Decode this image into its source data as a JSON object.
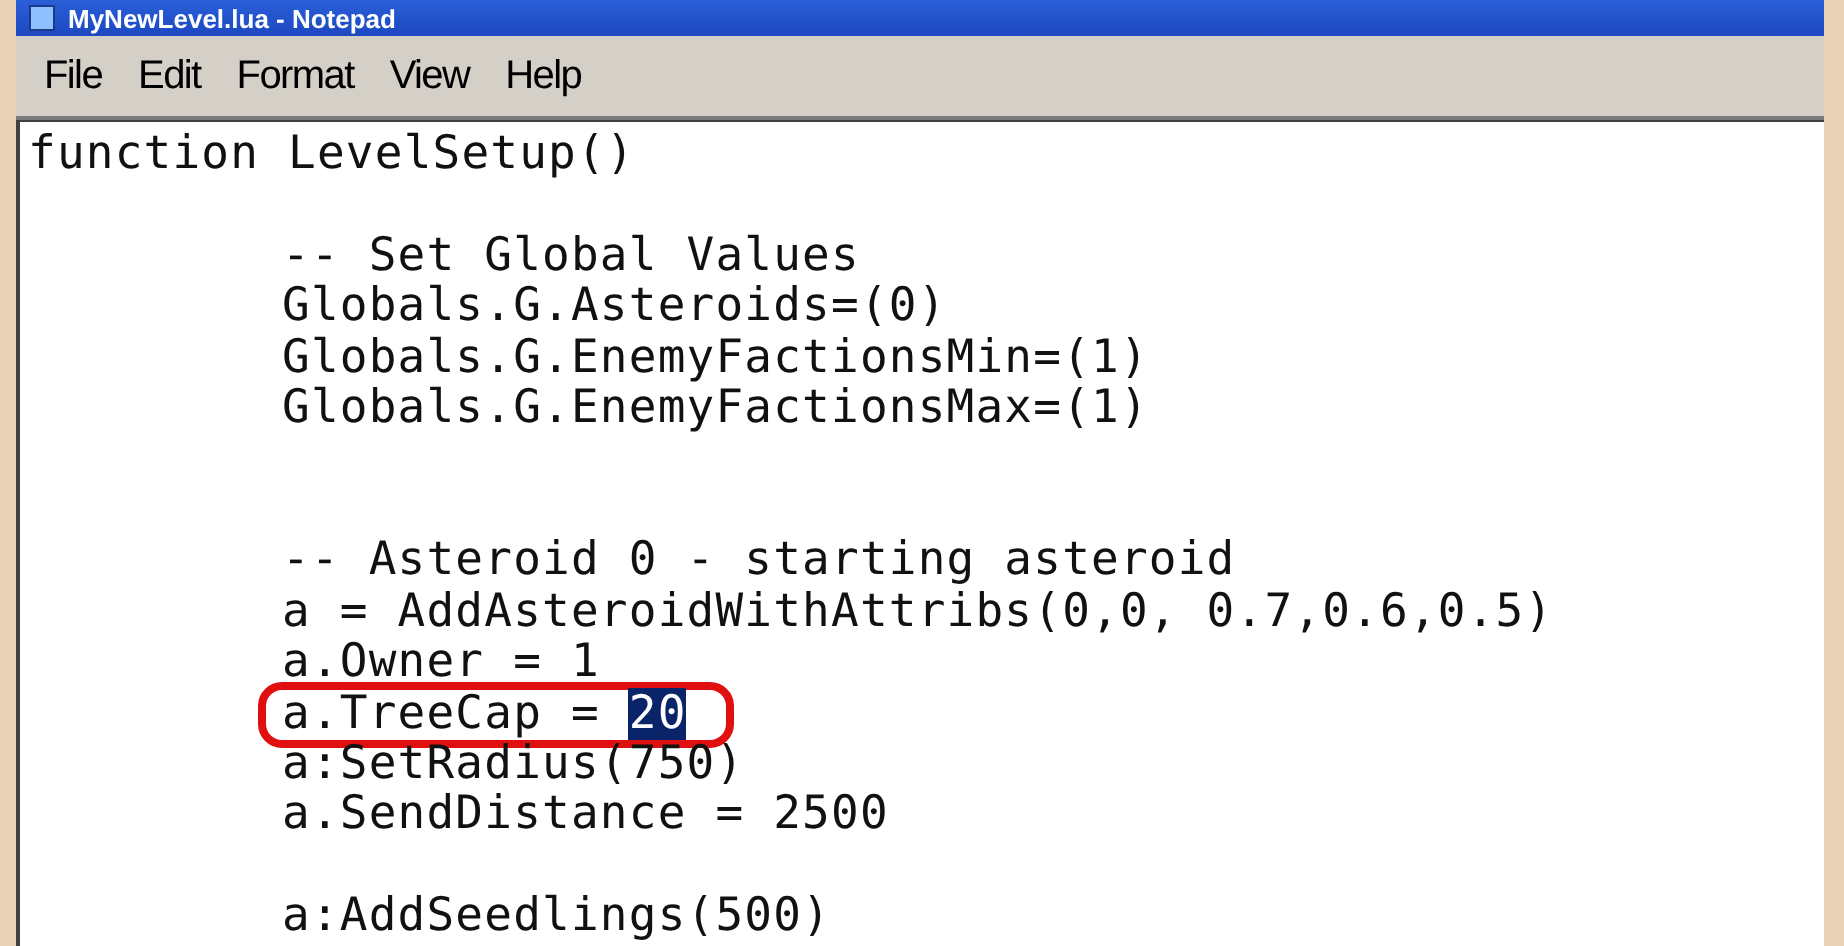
{
  "window": {
    "title": "MyNewLevel.lua - Notepad"
  },
  "menu": [
    "File",
    "Edit",
    "Format",
    "View",
    "Help"
  ],
  "lines": [
    {
      "kind": "top",
      "text": "function LevelSetup()"
    },
    {
      "kind": "gap"
    },
    {
      "kind": "body",
      "text": "-- Set Global Values"
    },
    {
      "kind": "body",
      "text": "Globals.G.Asteroids=(0)"
    },
    {
      "kind": "body",
      "text": "Globals.G.EnemyFactionsMin=(1)"
    },
    {
      "kind": "body",
      "text": "Globals.G.EnemyFactionsMax=(1)"
    },
    {
      "kind": "gap"
    },
    {
      "kind": "gap"
    },
    {
      "kind": "body",
      "text": "-- Asteroid 0 - starting asteroid"
    },
    {
      "kind": "body",
      "text": "a = AddAsteroidWithAttribs(0,0, 0.7,0.6,0.5)"
    },
    {
      "kind": "body",
      "text": "a.Owner = 1"
    },
    {
      "kind": "marked",
      "text": "a.TreeCap = ",
      "selection": "20"
    },
    {
      "kind": "body",
      "text": "a:SetRadius(750)"
    },
    {
      "kind": "body",
      "text": "a.SendDistance = 2500"
    },
    {
      "kind": "gap"
    },
    {
      "kind": "body",
      "text": "a:AddSeedlings(500)"
    }
  ]
}
